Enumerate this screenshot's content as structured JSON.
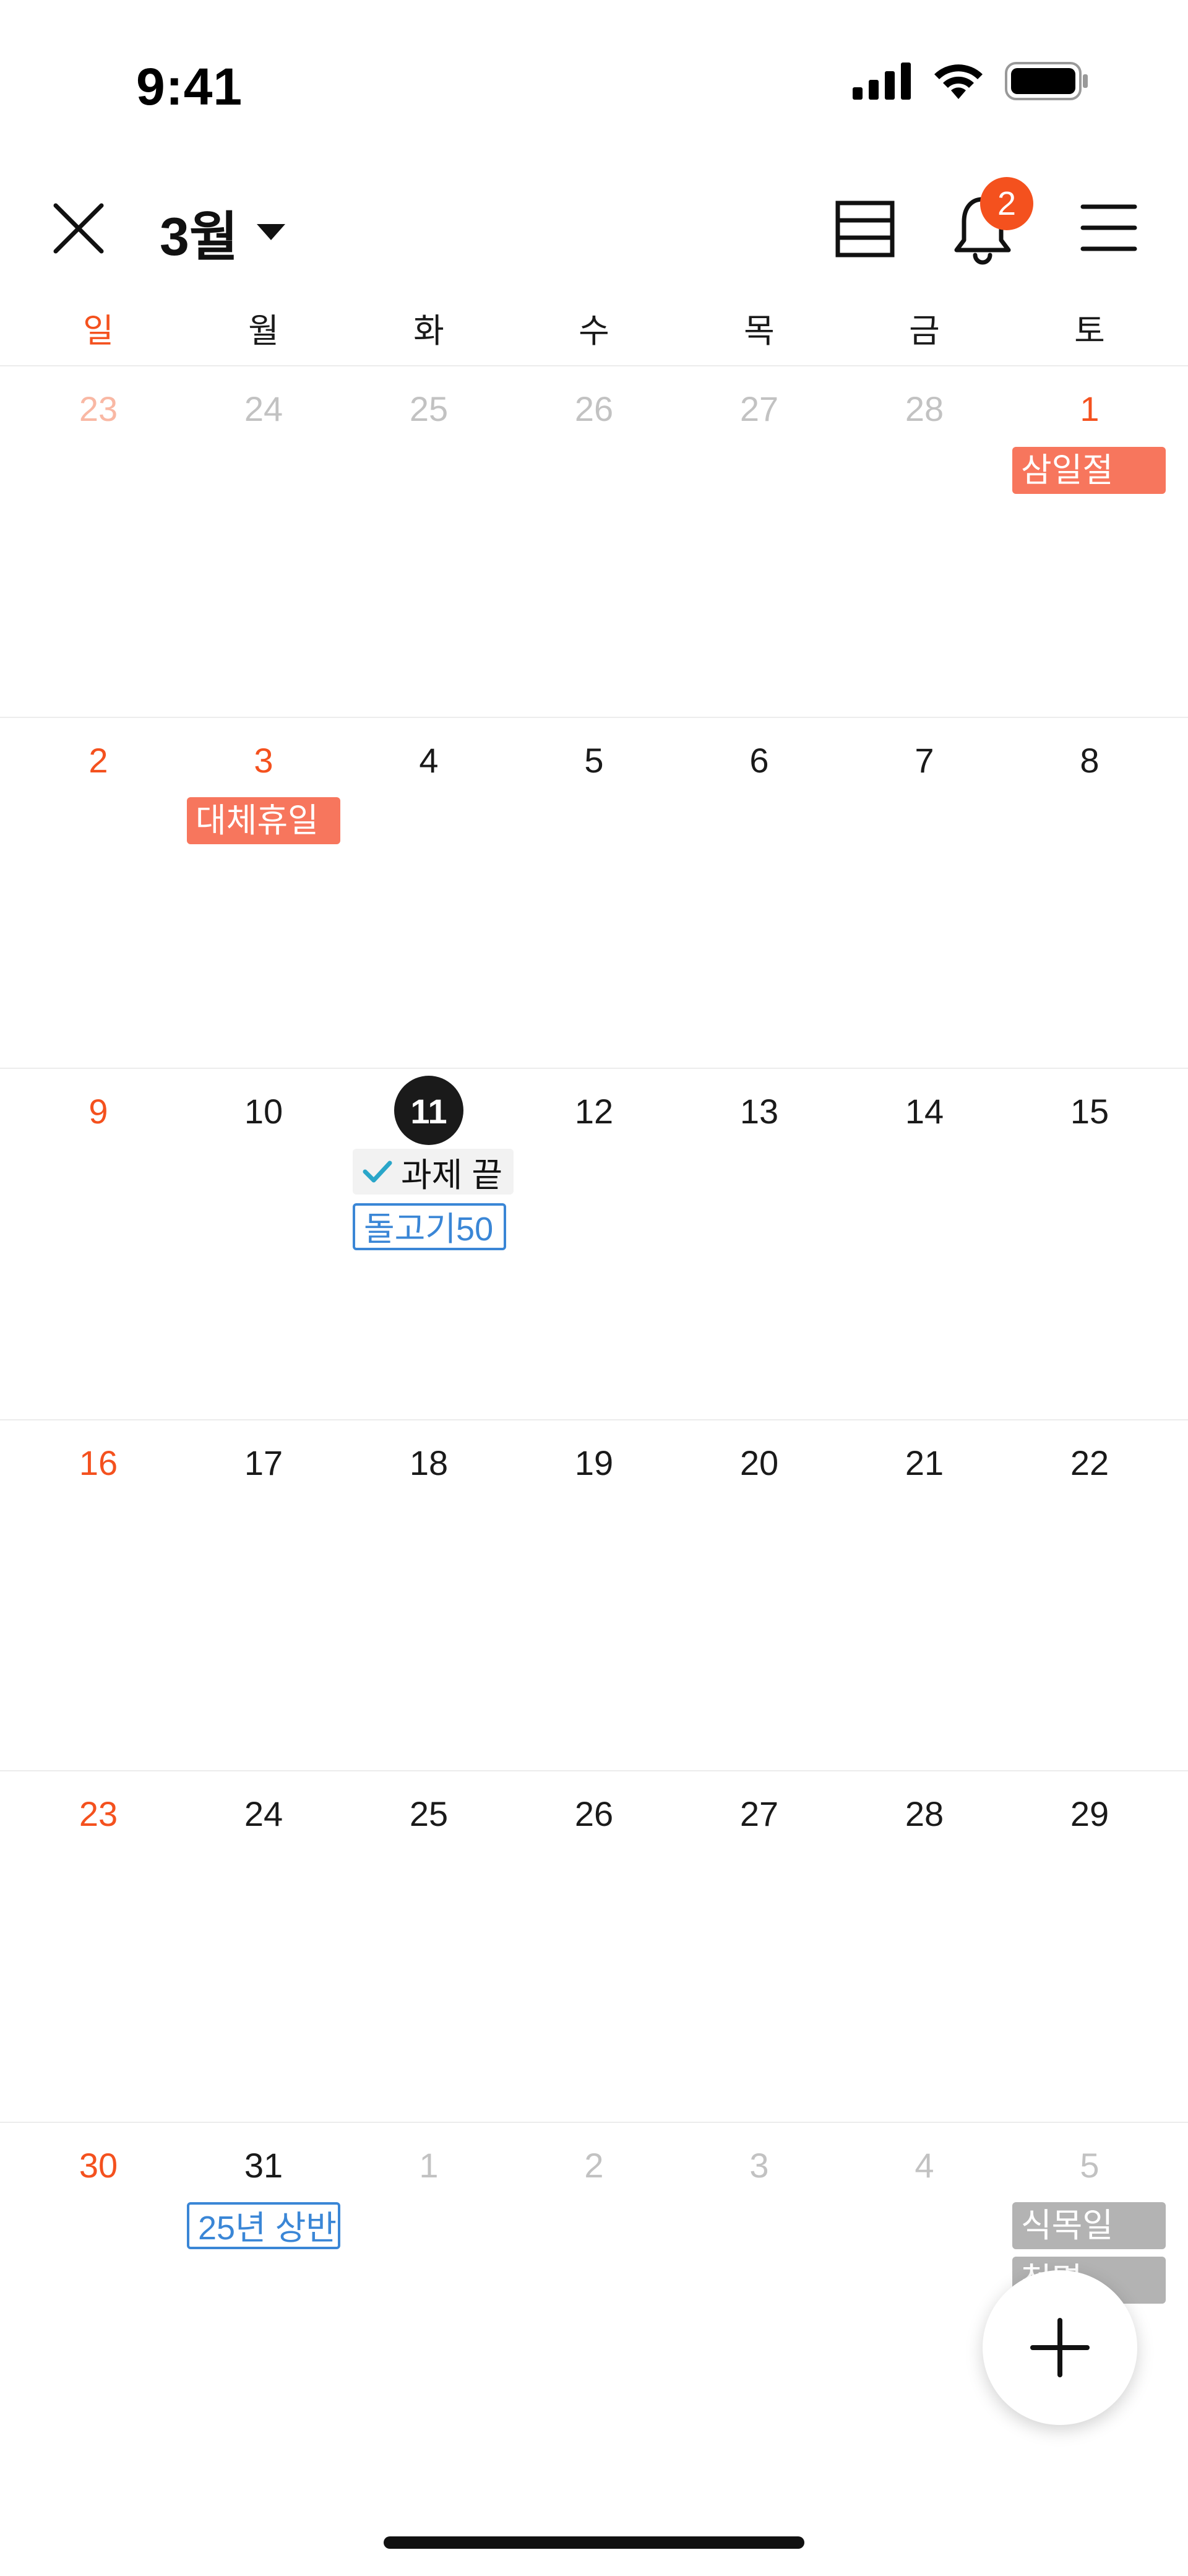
{
  "status_bar": {
    "time": "9:41"
  },
  "header": {
    "month_title": "3월",
    "notification_count": "2"
  },
  "weekdays": [
    "일",
    "월",
    "화",
    "수",
    "목",
    "금",
    "토"
  ],
  "weeks": [
    [
      "23",
      "24",
      "25",
      "26",
      "27",
      "28",
      "1"
    ],
    [
      "2",
      "3",
      "4",
      "5",
      "6",
      "7",
      "8"
    ],
    [
      "9",
      "10",
      "11",
      "12",
      "13",
      "14",
      "15"
    ],
    [
      "16",
      "17",
      "18",
      "19",
      "20",
      "21",
      "22"
    ],
    [
      "23",
      "24",
      "25",
      "26",
      "27",
      "28",
      "29"
    ],
    [
      "30",
      "31",
      "1",
      "2",
      "3",
      "4",
      "5"
    ]
  ],
  "events": {
    "holiday_samiljeol": "삼일절",
    "holiday_substitute": "대체휴일",
    "task_done": "과제 끝",
    "event_dolgogi": "돌고기50",
    "event_25_first_half": "25년 상반",
    "holiday_arbor": "식목일",
    "event_cutoff": "청명"
  },
  "colors": {
    "sunday": "#f4511e",
    "today_bg": "#1a1a1a",
    "holiday_tag": "#f7765d",
    "outline_tag": "#3a86d6",
    "muted_date": "#c2c2c2"
  }
}
